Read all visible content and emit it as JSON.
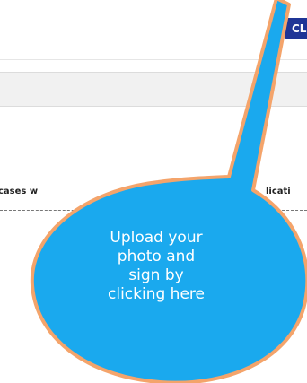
{
  "header": {
    "button_label": "CL"
  },
  "table": {
    "row_cell_left": "cases w",
    "row_cell_right": "licati"
  },
  "callout": {
    "lines": [
      "Upload your",
      "photo and",
      "sign by",
      "clicking here"
    ]
  },
  "colors": {
    "callout_fill": "#1aa9ee",
    "callout_border": "#f4a46b",
    "button_bg": "#1f3596"
  }
}
